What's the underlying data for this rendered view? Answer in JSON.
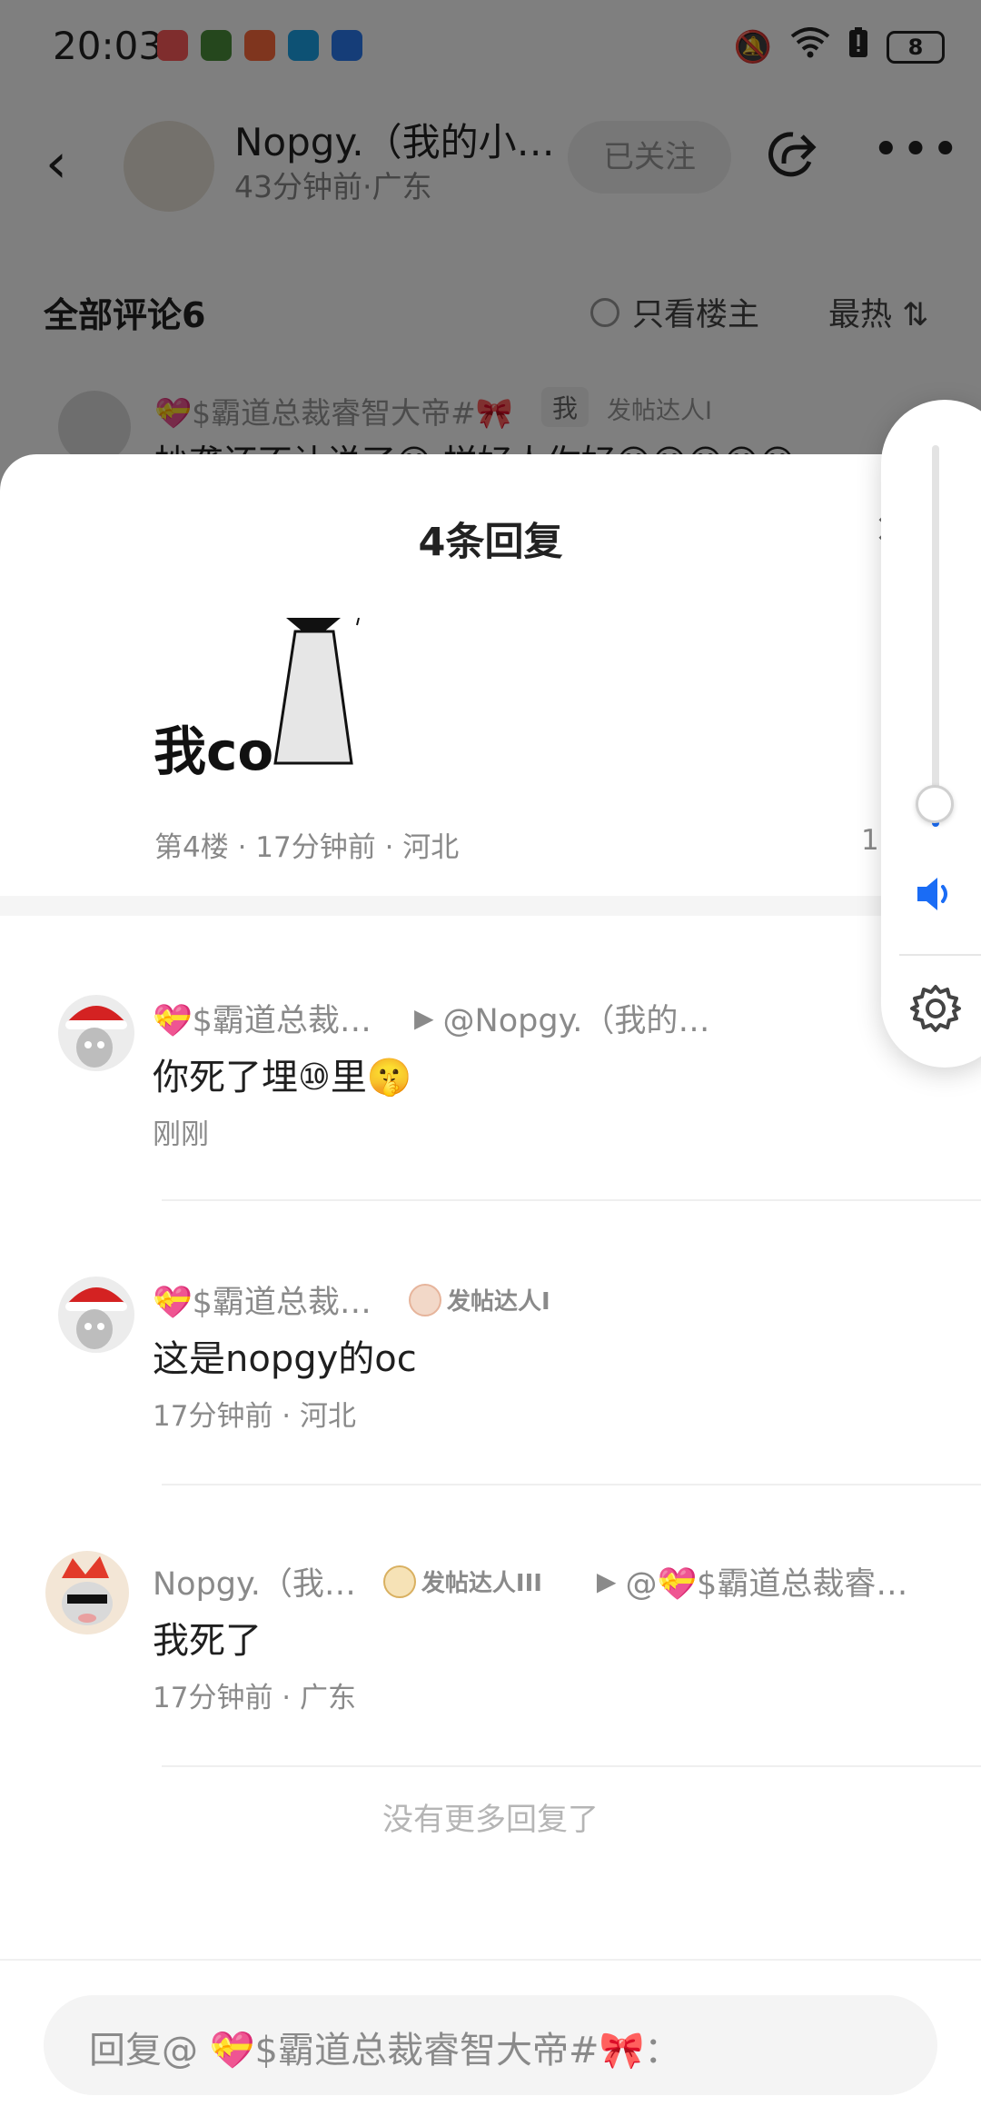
{
  "status_bar": {
    "time": "20:03",
    "battery": "8",
    "notification_icons": [
      "#ff5a5a",
      "#4a8f3a",
      "#ff6a3d",
      "#1aa3e8",
      "#2b7bf0"
    ],
    "system_icons": [
      "muted-bell-icon",
      "wifi-icon",
      "battery-saver-icon"
    ]
  },
  "header": {
    "name": "Nopgy.（我的小…",
    "subtitle": "43分钟前·广东",
    "follow_label": "已关注"
  },
  "comments_bar": {
    "title": "全部评论6",
    "only_op": "只看楼主",
    "sort": "最热 ⇅"
  },
  "bg_comment": {
    "name": "💝$霸道总裁睿智大帝#🎀",
    "tag": "我",
    "badge": "发帖达人I",
    "text": "抄袭还不让说了😅 样好人你好😊😊😊😊😊"
  },
  "sheet": {
    "title": "4条回复",
    "close": "✕",
    "original": {
      "image_text": "我co",
      "meta": "第4楼 · 17分钟前 · 河北",
      "like_count": "1"
    },
    "replies": [
      {
        "name": "💝$霸道总裁睿智大帝#🎀",
        "reply_to": "@Nopgy.（我的小…",
        "text": "你死了埋⑩里🤫",
        "meta": "刚刚"
      },
      {
        "name": "💝$霸道总裁睿智大帝#🎀",
        "badge": "发帖达人I",
        "text": "这是nopgy的oc",
        "meta": "17分钟前 · 河北"
      },
      {
        "name": "Nopgy.（我…",
        "badge": "发帖达人III",
        "reply_to": "@💝$霸道总裁睿…",
        "text": "我死了",
        "meta": "17分钟前 · 广东"
      }
    ],
    "no_more": "没有更多回复了",
    "input_placeholder": "回复@ 💝$霸道总裁睿智大帝#🎀："
  },
  "volume": {
    "level": 0.06,
    "accent": "#1a6cf5"
  }
}
